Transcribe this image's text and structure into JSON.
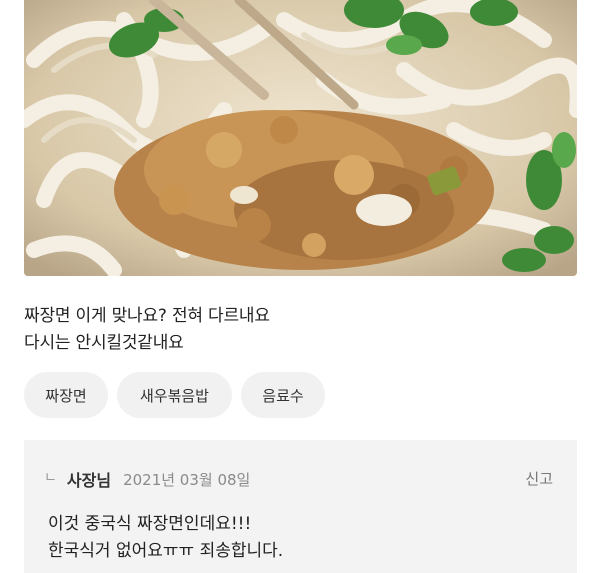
{
  "review": {
    "photo_description_icon": "food-photo",
    "lines": [
      "짜장면 이게 맞나요? 전혀 다르내요",
      "다시는 안시킬것같내요"
    ],
    "tags": [
      "짜장면",
      "새우볶음밥",
      "음료수"
    ]
  },
  "owner_reply": {
    "arrow": "ㄴ",
    "author": "사장님",
    "date": "2021년 03월 08일",
    "report_label": "신고",
    "lines": [
      "이것 중국식 짜장면인데요!!!",
      "한국식거 없어요ㅠㅠ 죄송합니다."
    ]
  }
}
